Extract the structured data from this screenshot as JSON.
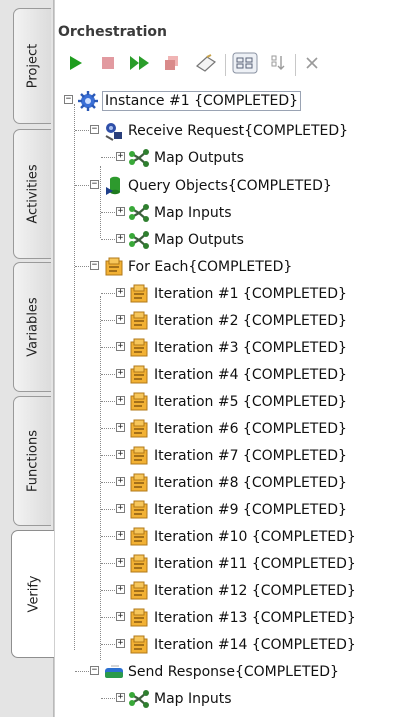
{
  "side_tabs": [
    {
      "label": "Project",
      "active": false
    },
    {
      "label": "Activities",
      "active": false
    },
    {
      "label": "Variables",
      "active": false
    },
    {
      "label": "Functions",
      "active": false
    },
    {
      "label": "Verify",
      "active": true
    }
  ],
  "panel": {
    "title": "Orchestration"
  },
  "toolbar": {
    "buttons": [
      {
        "name": "run-icon"
      },
      {
        "name": "stop-icon"
      },
      {
        "name": "fast-forward-icon"
      },
      {
        "name": "delete-icon"
      },
      {
        "name": "clear-icon"
      },
      {
        "name": "layout-icon"
      },
      {
        "name": "step-icon"
      },
      {
        "name": "close-icon"
      }
    ]
  },
  "tree": {
    "instance": "Instance #1 {COMPLETED}",
    "receive": "Receive Request{COMPLETED}",
    "receive_map_outputs": "Map Outputs",
    "query": "Query Objects{COMPLETED}",
    "query_map_inputs": "Map Inputs",
    "query_map_outputs": "Map Outputs",
    "foreach": "For Each{COMPLETED}",
    "iterations": [
      "Iteration #1 {COMPLETED}",
      "Iteration #2 {COMPLETED}",
      "Iteration #3 {COMPLETED}",
      "Iteration #4 {COMPLETED}",
      "Iteration #5 {COMPLETED}",
      "Iteration #6 {COMPLETED}",
      "Iteration #7 {COMPLETED}",
      "Iteration #8 {COMPLETED}",
      "Iteration #9 {COMPLETED}",
      "Iteration #10 {COMPLETED}",
      "Iteration #11 {COMPLETED}",
      "Iteration #12 {COMPLETED}",
      "Iteration #13 {COMPLETED}",
      "Iteration #14 {COMPLETED}"
    ],
    "send": "Send Response{COMPLETED}",
    "send_map_inputs": "Map Inputs"
  }
}
